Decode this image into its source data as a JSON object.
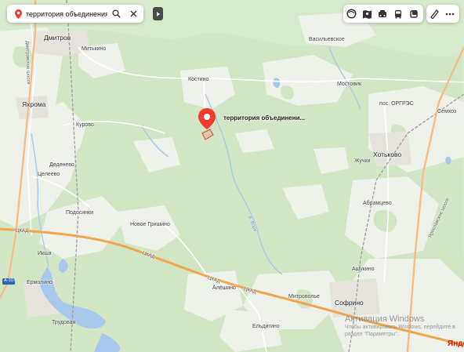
{
  "search": {
    "query": "территория объединения Серг",
    "icon": "location-pin-icon",
    "search_icon": "search-icon",
    "close_icon": "close-icon"
  },
  "toolbar": {
    "layers_icon": "layers-icon",
    "panorama_icon": "panorama-icon",
    "traffic_icon": "traffic-icon",
    "transit_icon": "transit-icon",
    "saved_icon": "saved-icon",
    "ruler_icon": "ruler-icon",
    "more_icon": "more-icon"
  },
  "marker": {
    "label": "территория объединени...",
    "color": "#f43a2c"
  },
  "places": {
    "dmitrov": "Дмитров",
    "mitkino": "Митькино",
    "dmitrovskoe": "Дмитровское шоссе",
    "yakhroma": "Яхрома",
    "kurovo": "Курово",
    "dedenevo": "Деденево",
    "tselevo": "Целеево",
    "podosinki": "Подосинки",
    "novoe_grishino": "Новое Гришино",
    "ckad_west": "ЦКАД",
    "iksha": "Икша",
    "ermolino": "Ермолино",
    "trudovaya": "Трудовая",
    "a107": "А-107",
    "kostino": "Костино",
    "vasilevskoe": "Васильевское",
    "mostovik": "Мостовик",
    "pos_orgres": "пос. ОРГРЭС",
    "semkhoz": "Семхоз",
    "khotkovo": "Хотьково",
    "zhuchki": "Жучки",
    "abramtsevo": "Абрамцево",
    "ashukino": "Ашукино",
    "sofrino": "Софрино",
    "mitropolye": "Митрополье",
    "eldigino": "Ельдигино",
    "alyoshino": "Алёшино",
    "ckad_1": "ЦКАД",
    "ckad_2": "ЦКАД",
    "ckad_3": "ЦКАД",
    "yaroslavskoe": "Ярославское шоссе",
    "vorya": "р. Воря"
  },
  "watermark": {
    "title": "Активация Windows",
    "line1": "Чтобы активировать Windows, перейдите в",
    "line2": "раздел \"Параметры\"."
  },
  "logo": "Янде",
  "colors": {
    "land": "#eef2ea",
    "forest": "#d2e6c6",
    "water": "#a9c9ec",
    "road": "#f6c59a",
    "road_main": "#f0a54f",
    "railway": "#9b9b9b"
  }
}
